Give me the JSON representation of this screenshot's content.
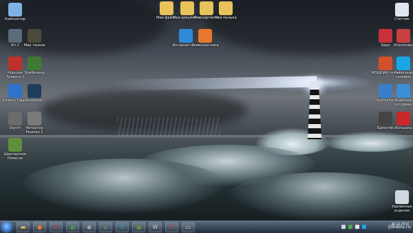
{
  "desktop": {
    "icons_left": [
      {
        "label": "Компьютер",
        "icon": "computer-icon",
        "color": "#7fb3e6"
      },
      {
        "label": "Ил-2",
        "icon": "il2-game-icon",
        "color": "#5b6b7b"
      },
      {
        "label": "Мир танков",
        "icon": "tanks-game-icon",
        "color": "#4a4a3a"
      },
      {
        "label": "Красная Тревога 3",
        "icon": "red-alert-icon",
        "color": "#c0302a"
      },
      {
        "label": "Зомбиленд",
        "icon": "zombie-game-icon",
        "color": "#3f7a32"
      },
      {
        "label": "Клиент Гарри",
        "icon": "garry-icon",
        "color": "#2e72c9"
      },
      {
        "label": "Эшпорекс",
        "icon": "steam-like-icon",
        "color": "#1f3d5c"
      },
      {
        "label": "Skyrim",
        "icon": "skyrim-icon",
        "color": "#6c6c6c"
      },
      {
        "label": "Нитратор Рашкин 2",
        "icon": "game-disc-icon",
        "color": "#7a7a7a"
      },
      {
        "label": "Шахтерское Ремесло",
        "icon": "minecraft-icon",
        "color": "#5f8f3a"
      }
    ],
    "icons_top": [
      {
        "label": "Мои файлы",
        "icon": "folder-icon",
        "color": "#e8c25a"
      },
      {
        "label": "Мои документы",
        "icon": "documents-folder-icon",
        "color": "#e8c25a"
      },
      {
        "label": "Мои картинки",
        "icon": "pictures-folder-icon",
        "color": "#e8c25a"
      },
      {
        "label": "Моя музыка",
        "icon": "music-folder-icon",
        "color": "#e8c25a"
      },
      {
        "label": "Интернет-экзп",
        "icon": "internet-explorer-icon",
        "color": "#2f8ad6"
      },
      {
        "label": "Огненная лиса",
        "icon": "firefox-icon",
        "color": "#e8772e"
      }
    ],
    "icons_right": [
      {
        "label": "Счетчик",
        "icon": "calculator-icon",
        "color": "#dfe6ee"
      },
      {
        "label": "Ядро",
        "icon": "adobe-icon",
        "color": "#c8303a"
      },
      {
        "label": "Игрополис",
        "icon": "games-icon",
        "color": "#c84040"
      },
      {
        "label": "МОЩНАЯ точка",
        "icon": "powerpoint-icon",
        "color": "#d2502a"
      },
      {
        "label": "Небесный телефон",
        "icon": "skype-icon",
        "color": "#18a6e6"
      },
      {
        "label": "SpyHunter",
        "icon": "spyhunter-icon",
        "color": "#3a7ec9"
      },
      {
        "label": "Водитель штурман",
        "icon": "navigator-icon",
        "color": "#3a8fd6"
      },
      {
        "label": "Единство",
        "icon": "unity-icon",
        "color": "#444444"
      },
      {
        "label": "Вспышка",
        "icon": "flash-icon",
        "color": "#c8282a"
      },
      {
        "label": "Удаленные изделия",
        "icon": "recycle-bin-icon",
        "color": "#cfd8df"
      }
    ]
  },
  "taskbar": {
    "items": [
      {
        "icon": "explorer-folder-icon",
        "glyph": "▬",
        "color": "#e8c25a"
      },
      {
        "icon": "firefox-icon",
        "glyph": "●",
        "color": "#e8772e"
      },
      {
        "icon": "opera-icon",
        "glyph": "O",
        "color": "#d0302a"
      },
      {
        "icon": "task-manager-icon",
        "glyph": "▦",
        "color": "#4aa04a"
      },
      {
        "icon": "steam-icon",
        "glyph": "◉",
        "color": "#9fb3c6"
      },
      {
        "icon": "torrent-icon",
        "glyph": "µ",
        "color": "#5fb84a"
      },
      {
        "icon": "skype-icon",
        "glyph": "S",
        "color": "#18a6e6"
      },
      {
        "icon": "minecraft-icon",
        "glyph": "■",
        "color": "#5f8f3a"
      },
      {
        "icon": "tanks-game-icon",
        "glyph": "W",
        "color": "#c8c8c8"
      },
      {
        "icon": "red-app-icon",
        "glyph": "Z",
        "color": "#d03a2a"
      },
      {
        "icon": "active-window-icon",
        "glyph": "▭",
        "color": "#bcd8f2"
      }
    ],
    "clock_date": "30.12.2014",
    "watermark": "pikabu.ru"
  }
}
